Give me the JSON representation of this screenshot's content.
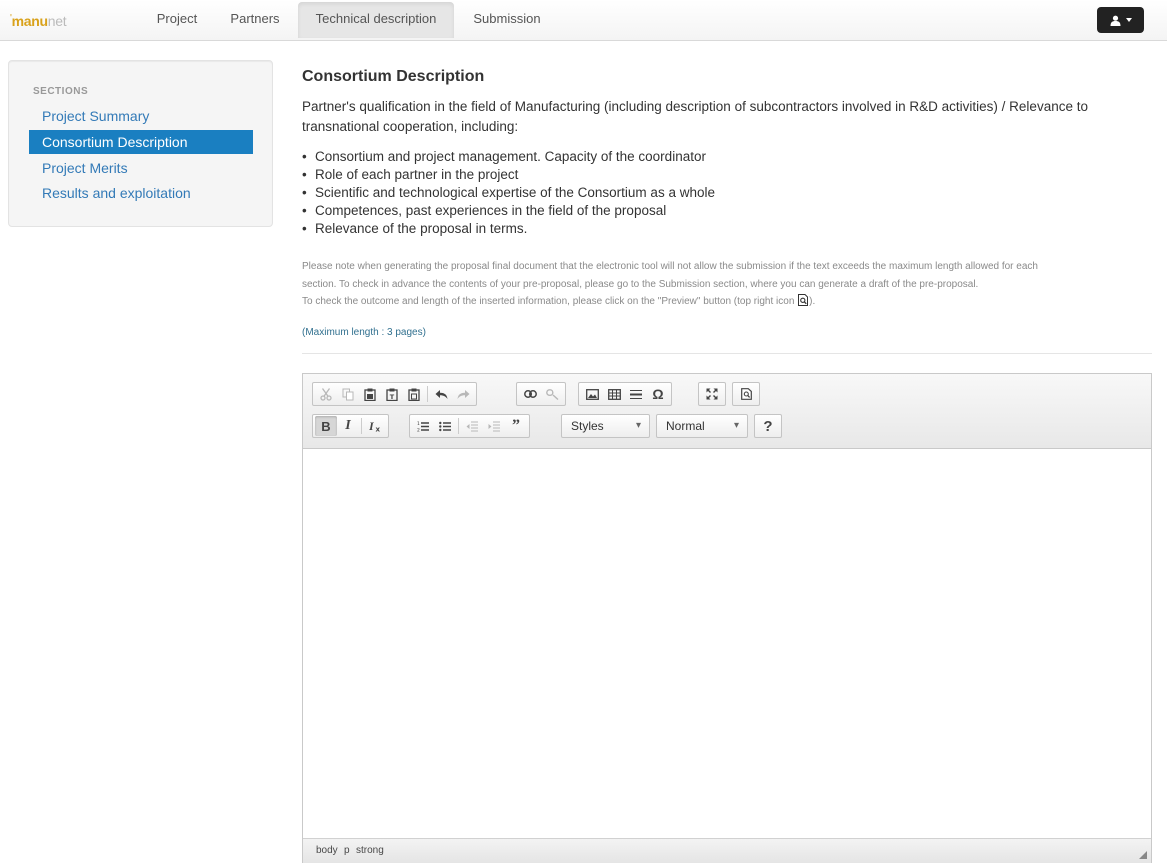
{
  "brand": {
    "part1": "manu",
    "part2": "net"
  },
  "nav": {
    "tabs": [
      {
        "label": "Project"
      },
      {
        "label": "Partners"
      },
      {
        "label": "Technical description"
      },
      {
        "label": "Submission"
      }
    ],
    "active_tab": "Technical description"
  },
  "sidebar": {
    "heading": "SECTIONS",
    "items": [
      {
        "label": "Project Summary"
      },
      {
        "label": "Consortium Description"
      },
      {
        "label": "Project Merits"
      },
      {
        "label": "Results and exploitation"
      }
    ],
    "active_item": "Consortium Description"
  },
  "main": {
    "title": "Consortium Description",
    "intro": "Partner's qualification in the field of Manufacturing (including description of subcontractors involved in R&D activities) / Relevance to transnational cooperation, including:",
    "bullets": [
      "Consortium and project management. Capacity of the coordinator",
      "Role of each partner in the project",
      "Scientific and technological expertise of the Consortium as a whole",
      "Competences, past experiences in the field of the proposal",
      "Relevance of the proposal in terms."
    ],
    "note_line1": "Please note when generating the proposal final document that the electronic tool will not allow the submission if the text exceeds the maximum length allowed for each",
    "note_line2": "section. To check in advance the contents of your pre-proposal, please go to the Submission section, where you can generate a draft of the pre-proposal.",
    "note_line3": "To check the outcome and length of the inserted information, please click on the \"Preview\" button (top right icon",
    "note_line3_end": ").",
    "max_length": "(Maximum length : 3 pages)"
  },
  "editor": {
    "styles_combo": "Styles",
    "format_combo": "Normal",
    "bold_label": "B",
    "italic_label": "I",
    "help_label": "?",
    "path": [
      "body",
      "p",
      "strong"
    ]
  },
  "colors": {
    "accent": "#1a7fc1",
    "link": "#337ab7",
    "brand": "#d9a21b"
  }
}
